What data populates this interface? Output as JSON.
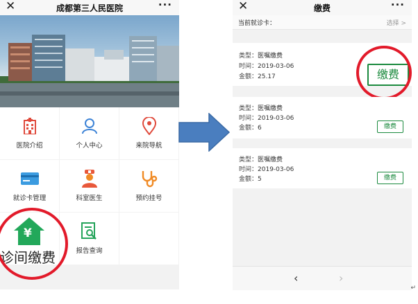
{
  "left_screen": {
    "title": "成都第三人民医院",
    "close_glyph": "✕",
    "more_glyph": "···",
    "menu": [
      {
        "label": "医院介绍",
        "icon": "hospital-building-icon"
      },
      {
        "label": "个人中心",
        "icon": "user-icon"
      },
      {
        "label": "来院导航",
        "icon": "location-pin-icon"
      },
      {
        "label": "就诊卡管理",
        "icon": "card-icon"
      },
      {
        "label": "科室医生",
        "icon": "doctor-icon"
      },
      {
        "label": "预约挂号",
        "icon": "stethoscope-icon"
      },
      {
        "label": "诊间缴费",
        "icon": "payment-house-icon"
      },
      {
        "label": "报告查询",
        "icon": "report-search-icon"
      }
    ],
    "pay_symbol": "¥"
  },
  "right_screen": {
    "title": "缴费",
    "close_glyph": "✕",
    "more_glyph": "···",
    "current_card_label": "当前就诊卡：",
    "select_label": "选择",
    "select_chevron": ">",
    "bills": [
      {
        "type_key": "类型：",
        "type": "医嘱缴费",
        "time_key": "时间：",
        "time": "2019-03-06",
        "amount_key": "金额：",
        "amount": "25.17",
        "button": "缴费"
      },
      {
        "type_key": "类型：",
        "type": "医嘱缴费",
        "time_key": "时间：",
        "time": "2019-03-06",
        "amount_key": "金额：",
        "amount": "6",
        "button": "缴费"
      },
      {
        "type_key": "类型：",
        "type": "医嘱缴费",
        "time_key": "时间：",
        "time": "2019-03-06",
        "amount_key": "金额：",
        "amount": "5",
        "button": "缴费"
      }
    ],
    "nav_back": "‹",
    "nav_forward": "›"
  },
  "colors": {
    "accent_green": "#1b8a3e",
    "highlight_red": "#e21a2a",
    "arrow_blue": "#4a7ebf",
    "icon_red": "#e04a3c",
    "icon_blue": "#3b82d6",
    "icon_orange": "#f08a24",
    "icon_green": "#24a35a"
  },
  "stray_mark": "↵"
}
